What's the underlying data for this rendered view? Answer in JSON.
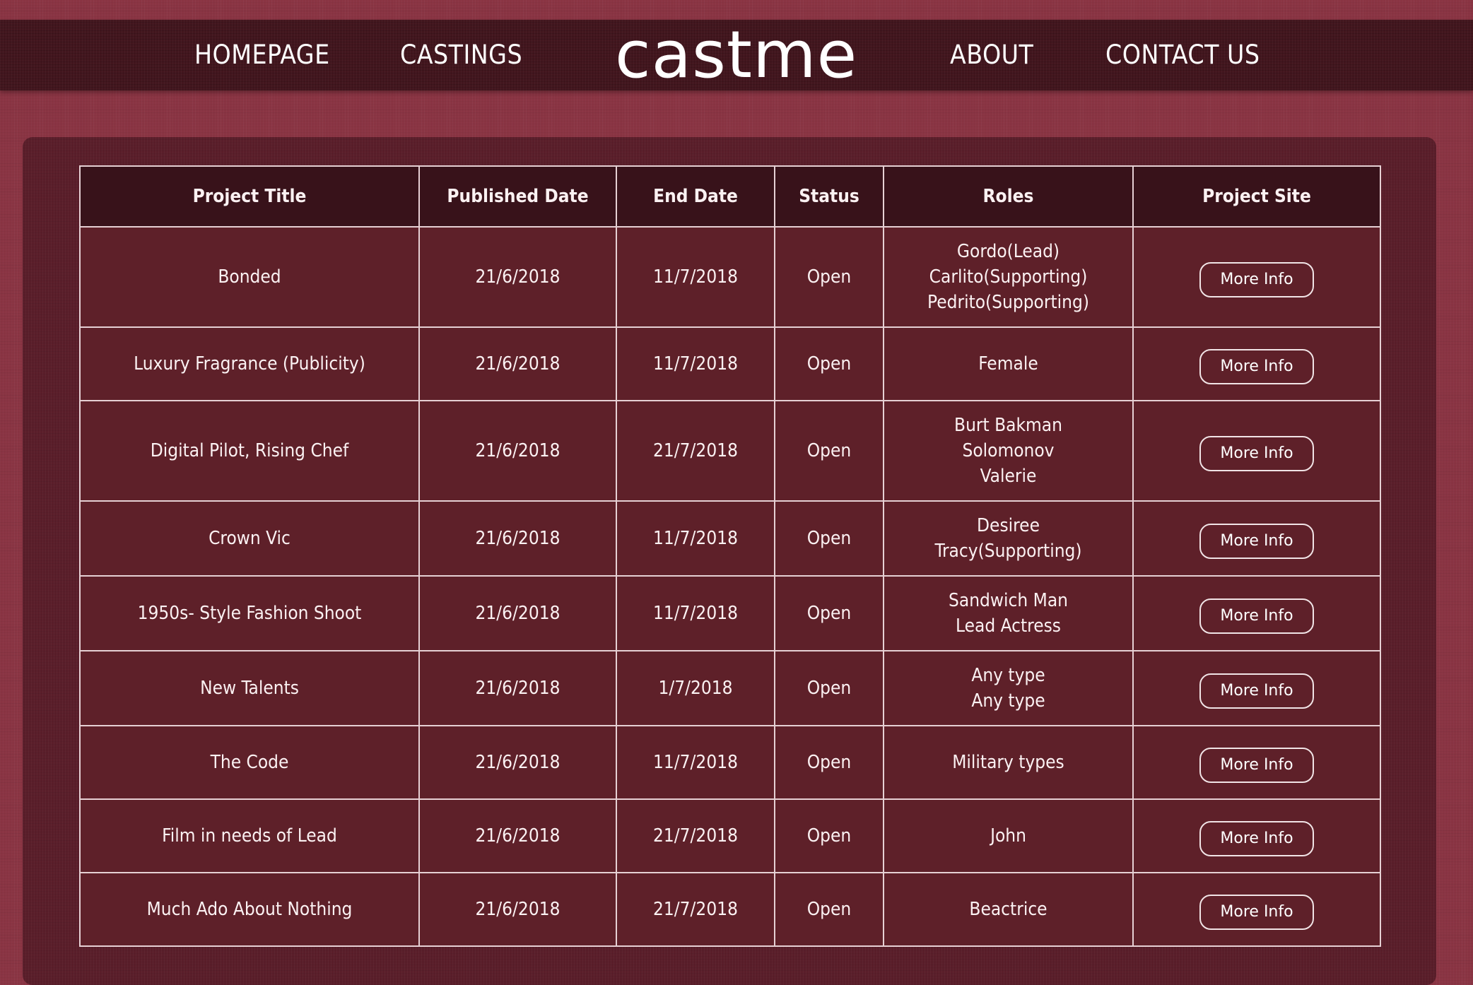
{
  "nav": {
    "homepage": "HOMEPAGE",
    "castings": "CASTINGS",
    "logo": "castme",
    "about": "ABOUT",
    "contact": "CONTACT US"
  },
  "table": {
    "headers": {
      "project_title": "Project Title",
      "published_date": "Published Date",
      "end_date": "End Date",
      "status": "Status",
      "roles": "Roles",
      "project_site": "Project Site"
    },
    "rows": [
      {
        "title": "Bonded",
        "published": "21/6/2018",
        "end": "11/7/2018",
        "status": "Open",
        "roles": [
          "Gordo(Lead)",
          "Carlito(Supporting)",
          "Pedrito(Supporting)"
        ],
        "button": "More Info"
      },
      {
        "title": "Luxury Fragrance (Publicity)",
        "published": "21/6/2018",
        "end": "11/7/2018",
        "status": "Open",
        "roles": [
          "Female"
        ],
        "button": "More Info"
      },
      {
        "title": "Digital Pilot, Rising Chef",
        "published": "21/6/2018",
        "end": "21/7/2018",
        "status": "Open",
        "roles": [
          "Burt Bakman",
          "Solomonov",
          "Valerie"
        ],
        "button": "More Info"
      },
      {
        "title": "Crown Vic",
        "published": "21/6/2018",
        "end": "11/7/2018",
        "status": "Open",
        "roles": [
          "Desiree",
          "Tracy(Supporting)"
        ],
        "button": "More Info"
      },
      {
        "title": "1950s- Style Fashion Shoot",
        "published": "21/6/2018",
        "end": "11/7/2018",
        "status": "Open",
        "roles": [
          "Sandwich Man",
          "Lead Actress"
        ],
        "button": "More Info"
      },
      {
        "title": "New Talents",
        "published": "21/6/2018",
        "end": "1/7/2018",
        "status": "Open",
        "roles": [
          "Any type",
          "Any type"
        ],
        "button": "More Info"
      },
      {
        "title": "The Code",
        "published": "21/6/2018",
        "end": "11/7/2018",
        "status": "Open",
        "roles": [
          "Military types"
        ],
        "button": "More Info"
      },
      {
        "title": "Film in needs of Lead",
        "published": "21/6/2018",
        "end": "21/7/2018",
        "status": "Open",
        "roles": [
          "John"
        ],
        "button": "More Info"
      },
      {
        "title": "Much Ado About Nothing",
        "published": "21/6/2018",
        "end": "21/7/2018",
        "status": "Open",
        "roles": [
          "Beactrice"
        ],
        "button": "More Info"
      }
    ]
  },
  "colors": {
    "page_background": "#8a3443",
    "navbar_background": "#42161e",
    "panel_background": "#5a1e2a",
    "table_header_background": "#38121a",
    "table_cell_background": "#5e2029",
    "border": "#e6d0d4",
    "text": "#ffffff"
  }
}
